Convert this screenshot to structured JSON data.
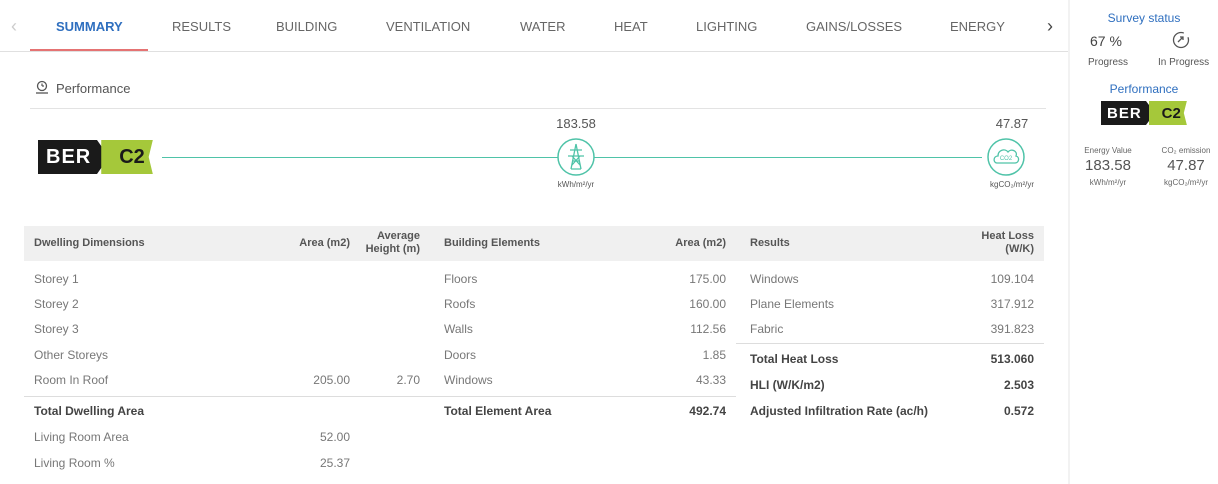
{
  "tabs": [
    "SUMMARY",
    "RESULTS",
    "BUILDING",
    "VENTILATION",
    "WATER",
    "HEAT",
    "LIGHTING",
    "GAINS/LOSSES",
    "ENERGY"
  ],
  "active_tab": "SUMMARY",
  "performance": {
    "title": "Performance",
    "ber": {
      "prefix": "BER",
      "rating": "C2"
    },
    "energy_value": "183.58",
    "energy_unit": "kWh/m²/yr",
    "co2_value": "47.87",
    "co2_unit": "kgCO₂/m²/yr"
  },
  "dwelling": {
    "headers": {
      "name": "Dwelling Dimensions",
      "area": "Area (m2)",
      "height": "Average Height (m)"
    },
    "rows": [
      {
        "name": "Storey 1",
        "area": "",
        "height": ""
      },
      {
        "name": "Storey 2",
        "area": "",
        "height": ""
      },
      {
        "name": "Storey 3",
        "area": "",
        "height": ""
      },
      {
        "name": "Other Storeys",
        "area": "",
        "height": ""
      },
      {
        "name": "Room In Roof",
        "area": "205.00",
        "height": "2.70"
      }
    ],
    "total_label": "Total Dwelling Area",
    "total_value": "",
    "extra": [
      {
        "name": "Living Room Area",
        "area": "52.00"
      },
      {
        "name": "Living Room %",
        "area": "25.37"
      }
    ]
  },
  "elements": {
    "headers": {
      "name": "Building Elements",
      "area": "Area (m2)"
    },
    "rows": [
      {
        "name": "Floors",
        "area": "175.00"
      },
      {
        "name": "Roofs",
        "area": "160.00"
      },
      {
        "name": "Walls",
        "area": "112.56"
      },
      {
        "name": "Doors",
        "area": "1.85"
      },
      {
        "name": "Windows",
        "area": "43.33"
      }
    ],
    "total_label": "Total Element Area",
    "total_value": "492.74"
  },
  "results": {
    "headers": {
      "name": "Results",
      "value": "Heat Loss (W/K)"
    },
    "rows": [
      {
        "name": "Windows",
        "value": "109.104"
      },
      {
        "name": "Plane Elements",
        "value": "317.912"
      },
      {
        "name": "Fabric",
        "value": "391.823"
      }
    ],
    "bold_rows": [
      {
        "name": "Total Heat Loss",
        "value": "513.060"
      },
      {
        "name": "HLI (W/K/m2)",
        "value": "2.503"
      },
      {
        "name": "Adjusted Infiltration Rate (ac/h)",
        "value": "0.572"
      }
    ]
  },
  "side": {
    "survey_title": "Survey status",
    "progress_value": "67 %",
    "progress_label": "Progress",
    "status_label": "In Progress",
    "performance_title": "Performance",
    "energy_label": "Energy Value",
    "energy_value": "183.58",
    "energy_unit": "kWh/m²/yr",
    "co2_label": "CO₂ emission",
    "co2_value": "47.87",
    "co2_unit": "kgCO₂/m²/yr"
  },
  "colors": {
    "accent": "#2f6fbf",
    "active_underline": "#e57373",
    "track": "#4fc3a8",
    "ber_green": "#a5c83a"
  }
}
